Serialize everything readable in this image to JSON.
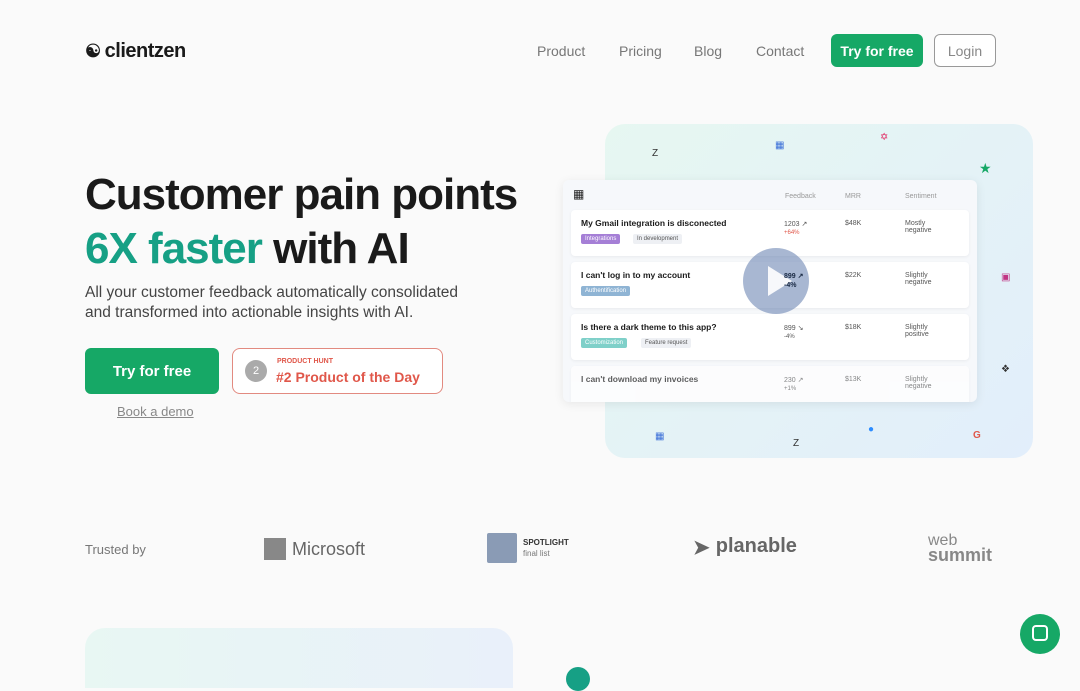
{
  "brand": {
    "name": "clientzen"
  },
  "nav": {
    "items": [
      "Product",
      "Pricing",
      "Blog",
      "Contact"
    ],
    "try_label": "Try for free",
    "login_label": "Login"
  },
  "hero": {
    "title_line1": "Customer pain points",
    "title_accent": "6X faster",
    "title_rest": " with AI",
    "subtitle": "All your customer feedback automatically consolidated and transformed into actionable insights with AI.",
    "cta": "Try for free",
    "demo": "Book a demo",
    "badge_top": "PRODUCT HUNT",
    "badge_main": "#2 Product of the Day",
    "badge_rank": "2"
  },
  "mockup": {
    "headers": [
      "Feedback",
      "MRR",
      "Sentiment"
    ],
    "rows": [
      {
        "title": "My Gmail integration is disconected",
        "tags": [
          "Integrations",
          "In development"
        ],
        "feedback": "1203 ↗",
        "change": "+64%",
        "mrr": "$48K",
        "sentiment": "Mostly negative"
      },
      {
        "title": "I can't log in to my account",
        "tags": [
          "Authentification"
        ],
        "feedback": "899 ↗",
        "change": "-4%",
        "mrr": "$22K",
        "sentiment": "Slightly negative"
      },
      {
        "title": "Is there a dark theme to this app?",
        "tags": [
          "Customization",
          "Feature request"
        ],
        "feedback": "899 ↘",
        "change": "-4%",
        "mrr": "$18K",
        "sentiment": "Slightly positive"
      },
      {
        "title": "I can't download my invoices",
        "tags": [
          ""
        ],
        "feedback": "230 ↗",
        "change": "+1%",
        "mrr": "$13K",
        "sentiment": "Slightly negative"
      }
    ]
  },
  "trusted": {
    "label": "Trusted by",
    "logos": [
      "Microsoft",
      "SPOTLIGHT",
      "final list",
      "planable",
      "web",
      "summit"
    ]
  },
  "colors": {
    "accent": "#16a866",
    "teal": "#16a085",
    "badge": "#e0574a"
  }
}
